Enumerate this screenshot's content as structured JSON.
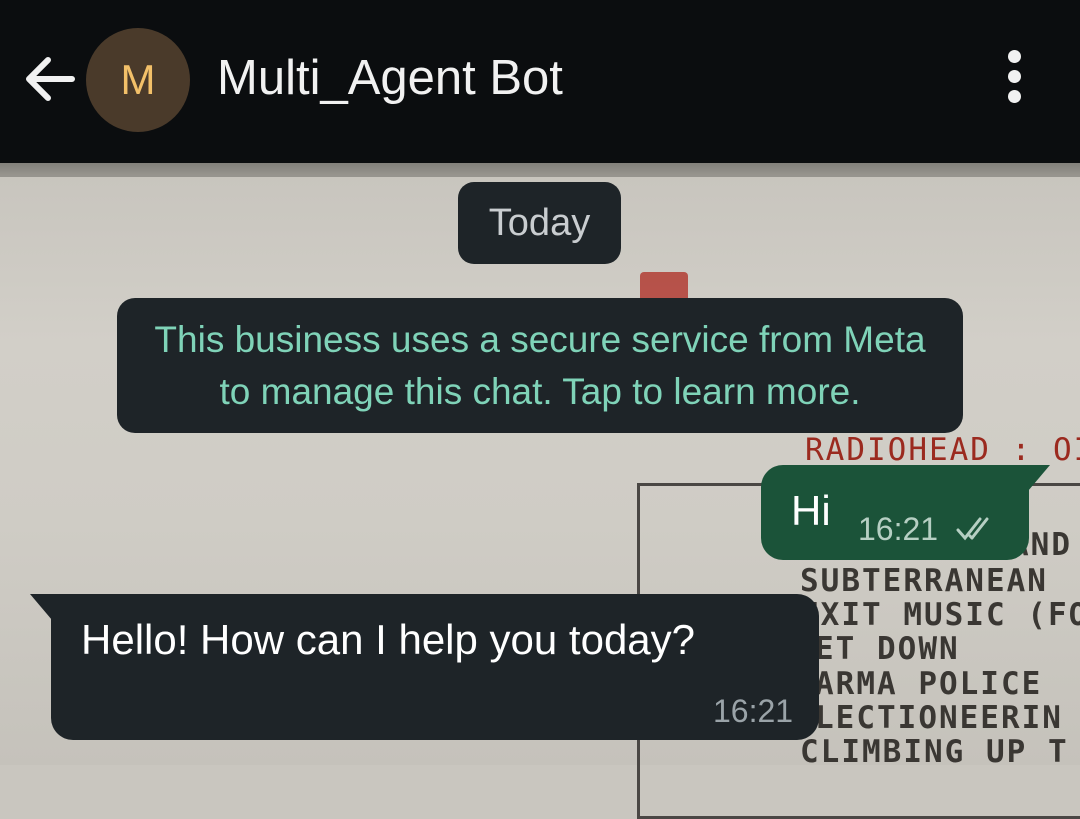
{
  "header": {
    "avatar_letter": "M",
    "title": "Multi_Agent Bot",
    "icons": [
      "arrow-left-icon",
      "more-vertical-icon"
    ],
    "avatar_color": "#4a3a2a",
    "avatar_letter_color": "#f2c069"
  },
  "chat": {
    "date_chip": "Today",
    "info_notice": "This business uses a secure service from Meta to manage this chat. Tap to learn more.",
    "messages": [
      {
        "direction": "outgoing",
        "text": "Hi",
        "time": "16:21",
        "status": "read",
        "bubble_color": "#1b5339"
      },
      {
        "direction": "incoming",
        "text": "Hello! How can I help you today?",
        "time": "16:21",
        "bubble_color": "#1e2428"
      }
    ]
  },
  "wallpaper": {
    "tracklist_head": "RADIOHEAD : OI",
    "tracklist_lines": [
      "AND",
      "SUBTERRANEAN",
      "EXIT MUSIC (FO",
      "ET DOWN",
      "ARMA POLICE",
      "LECTIONEERIN",
      "CLIMBING UP T"
    ]
  }
}
